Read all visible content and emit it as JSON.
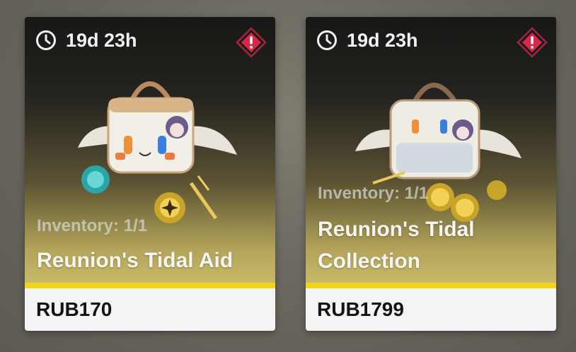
{
  "shop": {
    "items": [
      {
        "timer": "19d 23h",
        "inventory": "Inventory: 1/1",
        "name": "Reunion's Tidal Aid",
        "price": "RUB170",
        "icons": {
          "timer": "clock-icon",
          "alert": "alert-diamond-icon"
        },
        "colors": {
          "accent_strip": "#f1d51c",
          "alert": "#d6284a"
        }
      },
      {
        "timer": "19d 23h",
        "inventory": "Inventory: 1/1",
        "name_lines": [
          "Reunion's Tidal",
          "Collection"
        ],
        "price": "RUB1799",
        "icons": {
          "timer": "clock-icon",
          "alert": "alert-diamond-icon"
        },
        "colors": {
          "accent_strip": "#f1d51c",
          "alert": "#d6284a"
        }
      }
    ]
  }
}
